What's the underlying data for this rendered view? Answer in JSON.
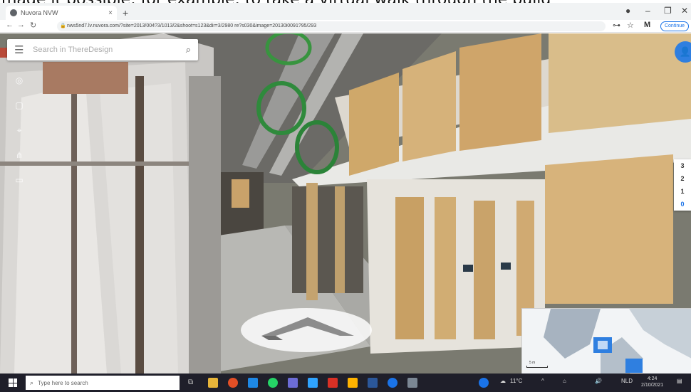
{
  "caption": "made it possible: for example: to take a virtual walk through the build",
  "browser": {
    "tab_title": "Nuvora NVW",
    "new_tab": "+",
    "close_tab": "×",
    "address": "nws5nd7.lv.nuvora.com/?site=2013/004?3/1013/2&shoot=s123&dir=3/2980 re?s030&image=20130i0091?95/293",
    "continue_label": "Continue",
    "win_minimize": "–",
    "win_restore": "❐",
    "win_close": "✕"
  },
  "viewer": {
    "search_placeholder": "Search in ThereDesign",
    "floors": [
      "3",
      "2",
      "1",
      "0"
    ],
    "active_floor": "0",
    "minimap_scale": "5 m"
  },
  "taskbar": {
    "search_placeholder": "Type here to search",
    "weather": "11°C",
    "time": "4:24",
    "date": "2/10/2021",
    "lang": "NLD"
  },
  "icons": {
    "menu": "hamburger-icon",
    "search": "search-icon",
    "user": "user-icon",
    "forward": "forward-arrow-icon"
  }
}
